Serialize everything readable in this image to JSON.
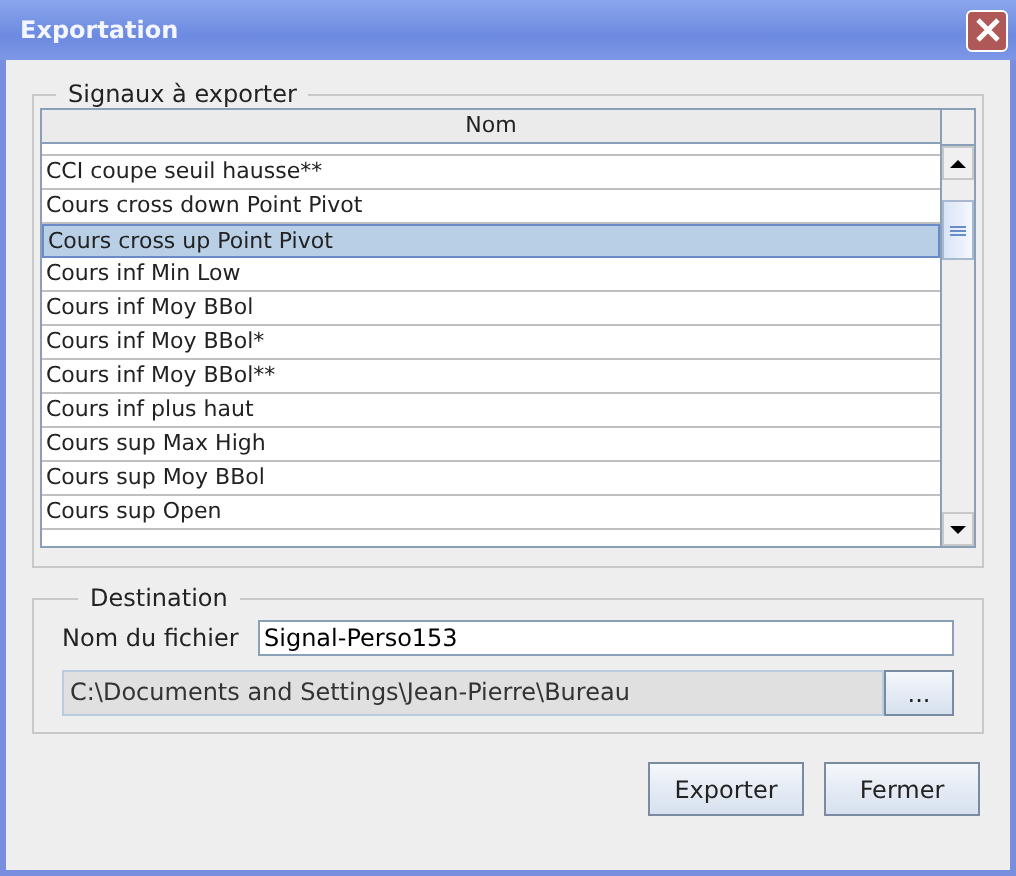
{
  "window": {
    "title": "Exportation"
  },
  "signals": {
    "legend": "Signaux à exporter",
    "column": "Nom",
    "rows": [
      {
        "name": "CCI coupe seuil hausse**",
        "selected": false
      },
      {
        "name": "Cours cross down Point Pivot",
        "selected": false
      },
      {
        "name": "Cours cross up Point Pivot",
        "selected": true
      },
      {
        "name": "Cours inf Min Low",
        "selected": false
      },
      {
        "name": "Cours inf Moy BBol",
        "selected": false
      },
      {
        "name": "Cours inf Moy BBol*",
        "selected": false
      },
      {
        "name": "Cours inf Moy BBol**",
        "selected": false
      },
      {
        "name": "Cours inf plus haut",
        "selected": false
      },
      {
        "name": "Cours sup Max High",
        "selected": false
      },
      {
        "name": "Cours sup Moy BBol",
        "selected": false
      },
      {
        "name": "Cours sup Open",
        "selected": false
      }
    ]
  },
  "destination": {
    "legend": "Destination",
    "file_label": "Nom du fichier",
    "file_value": "Signal-Perso153",
    "path": "C:\\Documents and Settings\\Jean-Pierre\\Bureau",
    "browse": "..."
  },
  "buttons": [
    "Exporter",
    "Fermer"
  ]
}
